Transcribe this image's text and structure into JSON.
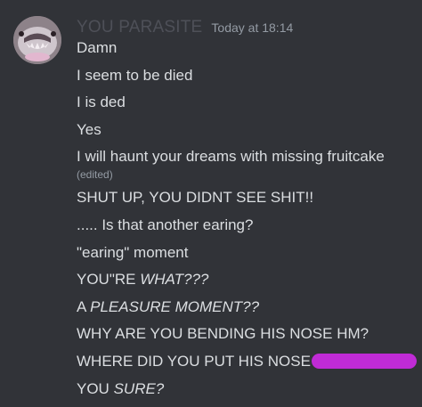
{
  "message": {
    "username": "YOU PARASITE",
    "timestamp": "Today at 18:14",
    "lines": [
      "Damn",
      "I seem to be died",
      "I is ded",
      "Yes",
      "I will haunt your dreams with missing fruitcake",
      "SHUT UP, YOU DIDNT SEE SHIT!!",
      "..... Is that another earing?",
      "\"earing\" moment",
      "YOU\"RE",
      "A",
      "WHY ARE YOU BENDING HIS NOSE HM?",
      "WHERE DID YOU PUT HIS NOSE",
      "YOU"
    ],
    "edited_label": "(edited)",
    "italic_parts": {
      "what": "WHAT???",
      "pleasure": "PLEASURE MOMENT??",
      "sure": "SURE?"
    }
  },
  "colors": {
    "background": "#313338",
    "text": "#dbdee1",
    "username": "#4e5058",
    "timestamp": "#949ba4",
    "redaction": "#c02bd6"
  }
}
